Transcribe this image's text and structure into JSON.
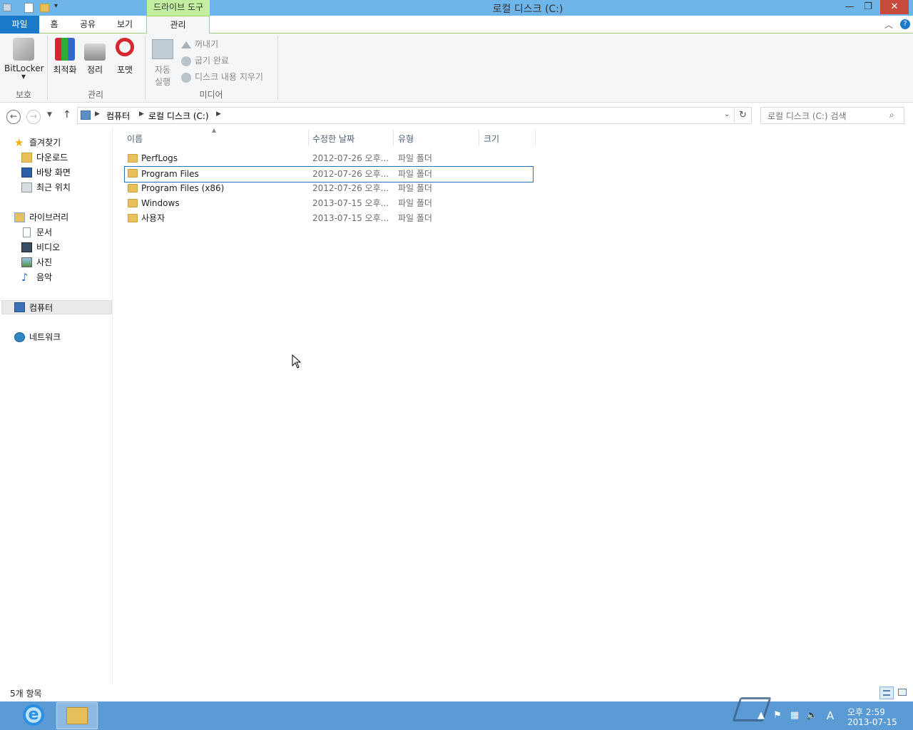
{
  "window": {
    "title": "로컬 디스크 (C:)",
    "context_tab_group": "드라이브 도구",
    "minimize_glyph": "—",
    "maximize_glyph": "❐",
    "close_glyph": "✕"
  },
  "ribbon_tabs": [
    {
      "label": "파일"
    },
    {
      "label": "홈"
    },
    {
      "label": "공유"
    },
    {
      "label": "보기"
    },
    {
      "label": "관리",
      "active": true
    }
  ],
  "ribbon": {
    "groups": {
      "protect": "보호",
      "manage": "관리",
      "media": "미디어"
    },
    "bitlocker": "BitLocker",
    "optimize": "최적화",
    "cleanup": "정리",
    "format": "포맷",
    "autoplay_line1": "자동",
    "autoplay_line2": "실행",
    "eject": "꺼내기",
    "finish_burning": "굽기 완료",
    "erase_disc": "디스크 내용 지우기"
  },
  "address": {
    "crumbs": [
      "컴퓨터",
      "로컬 디스크 (C:)"
    ],
    "search_placeholder": "로컬 디스크 (C:) 검색"
  },
  "sidebar": {
    "favorites": "즐겨찾기",
    "downloads": "다운로드",
    "desktop": "바탕 화면",
    "recent": "최근 위치",
    "libraries": "라이브러리",
    "documents": "문서",
    "videos": "비디오",
    "pictures": "사진",
    "music": "음악",
    "computer": "컴퓨터",
    "network": "네트워크"
  },
  "columns": {
    "name": "이름",
    "modified": "수정한 날짜",
    "type": "유형",
    "size": "크기"
  },
  "files": [
    {
      "name": "PerfLogs",
      "modified": "2012-07-26 오후...",
      "type": "파일 폴더"
    },
    {
      "name": "Program Files",
      "modified": "2012-07-26 오후...",
      "type": "파일 폴더"
    },
    {
      "name": "Program Files (x86)",
      "modified": "2012-07-26 오후...",
      "type": "파일 폴더"
    },
    {
      "name": "Windows",
      "modified": "2013-07-15 오후...",
      "type": "파일 폴더"
    },
    {
      "name": "사용자",
      "modified": "2013-07-15 오후...",
      "type": "파일 폴더"
    }
  ],
  "status": "5개 항목",
  "taskbar": {
    "time": "오후 2:59",
    "date": "2013-07-15",
    "ime": "A"
  },
  "colors": {
    "titlebar": "#6eb6ea",
    "context_tab": "#c2f0a0",
    "file_tab": "#1979ca",
    "taskbar": "#5b9bd5",
    "selection_border": "#2675bf"
  }
}
